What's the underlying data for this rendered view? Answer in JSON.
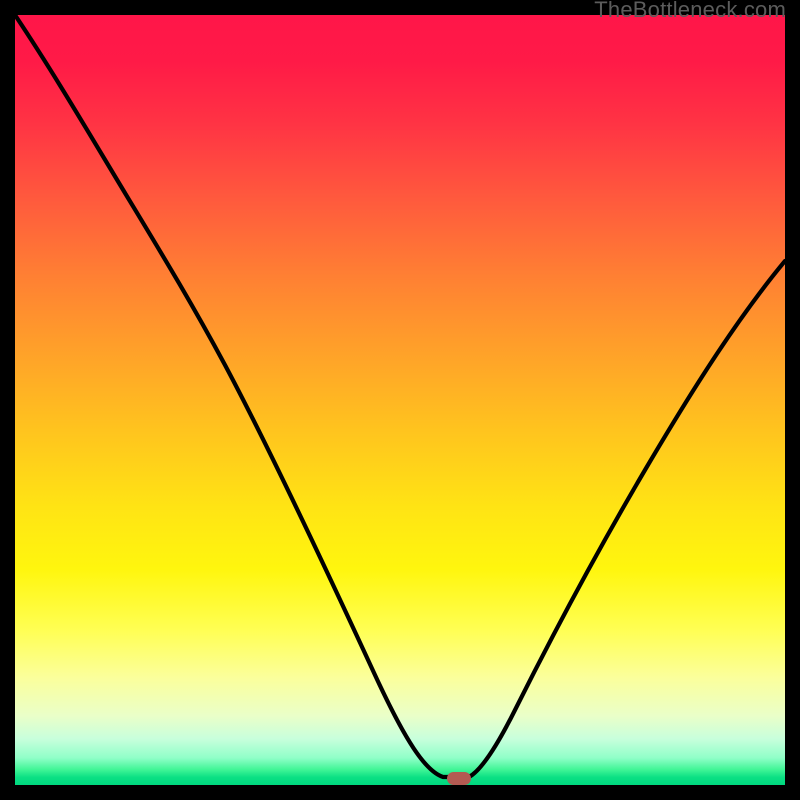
{
  "watermark": "TheBottleneck.com",
  "chart_data": {
    "type": "line",
    "title": "",
    "xlabel": "",
    "ylabel": "",
    "xlim": [
      0,
      100
    ],
    "ylim": [
      0,
      100
    ],
    "x": [
      0,
      6,
      12,
      18,
      24,
      30,
      36,
      42,
      48,
      52,
      55,
      57,
      58,
      59,
      62,
      65,
      70,
      76,
      82,
      88,
      94,
      100
    ],
    "values": [
      100,
      91,
      82,
      74,
      64,
      53,
      42,
      30,
      17,
      8,
      1,
      0,
      0,
      0,
      3,
      8,
      16,
      27,
      38,
      49,
      59,
      68
    ],
    "marker": {
      "x": 58,
      "y": 0,
      "color": "#b35a52",
      "shape": "pill"
    },
    "background": "red-yellow-green vertical gradient"
  }
}
